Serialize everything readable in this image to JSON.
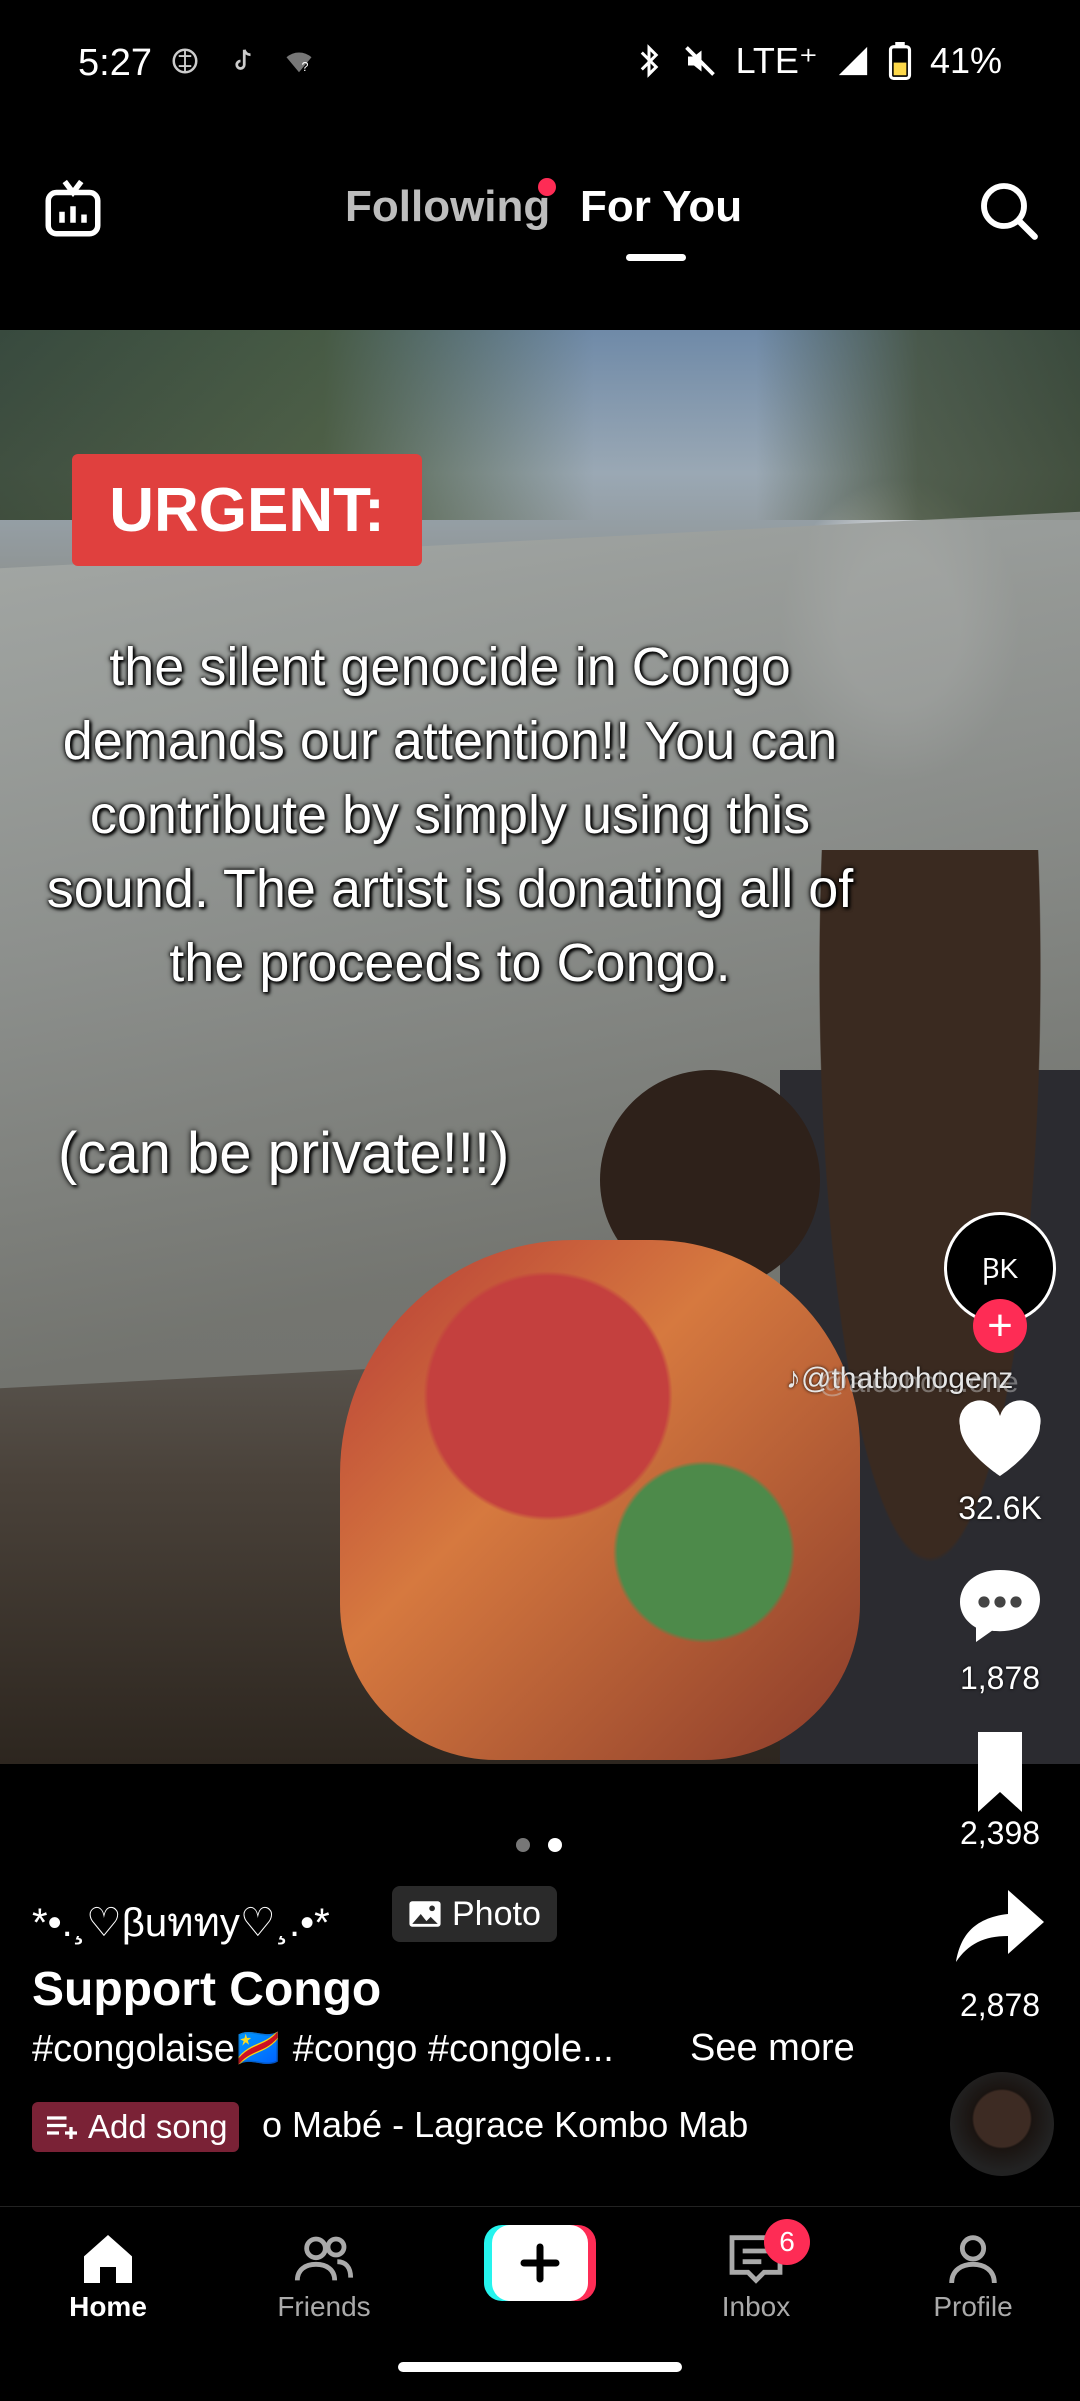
{
  "status_bar": {
    "time": "5:27",
    "network": "LTE⁺",
    "battery": "41%"
  },
  "top_nav": {
    "following": "Following",
    "for_you": "For You"
  },
  "post": {
    "badge": "URGENT:",
    "overlay_text": "the silent genocide in Congo demands our attention!! You can contribute by simply using this sound. The artist is donating all of the proceeds to Congo.",
    "overlay_private": "(can be private!!!)",
    "watermark_1": "@thatbohogenz",
    "watermark_2": "@alcohol...one",
    "avatar_initials": "ꞴK",
    "likes": "32.6K",
    "comments": "1,878",
    "saves": "2,398",
    "shares": "2,878",
    "username": "*•.¸♡βuททy♡¸.•*",
    "photo_label": "Photo",
    "title": "Support Congo",
    "hashtags": "#congolaise🇨🇩 #congo #congole...",
    "see_more": "See more",
    "add_song": "Add song",
    "song_ticker": "o Mabé - Lagrace    Kombo Mab"
  },
  "bottom_nav": {
    "home": "Home",
    "friends": "Friends",
    "inbox": "Inbox",
    "inbox_badge": "6",
    "profile": "Profile"
  },
  "colors": {
    "accent": "#fe2c55",
    "urgent_red": "#e0403e",
    "background": "#000000"
  },
  "icons": [
    "live-tv-icon",
    "search-icon",
    "heart-icon",
    "comment-icon",
    "bookmark-icon",
    "share-icon",
    "home-icon",
    "friends-icon",
    "plus-icon",
    "inbox-icon",
    "profile-icon"
  ]
}
